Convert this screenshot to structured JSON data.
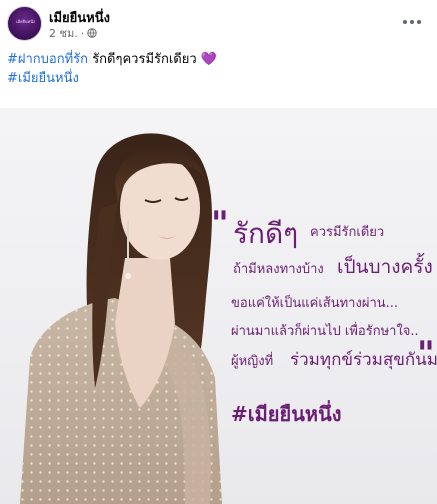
{
  "post": {
    "author": "เมียยืนหนึ่ง",
    "time": "2 ชม.",
    "separator": "·",
    "privacy_icon": "globe-icon",
    "more_icon": "more-options-icon",
    "avatar_text": "เมียยืนหนึ่ง"
  },
  "caption": {
    "hashtag1": "#ฝากบอกที่รัก",
    "text": "รักดีๆควรมีรักเดียว",
    "emoji": "💜",
    "hashtag2": "#เมียยืนหนึ่ง"
  },
  "image": {
    "quote_open": "\"",
    "quote_close": "\"",
    "line1_big": "รักดีๆ",
    "line1_small": "ควรมีรักเดียว",
    "line2_a": "ถ้ามีหลงทางบ้าง",
    "line2_b": "เป็นบางครั้ง",
    "line3": "ขอแค่ให้เป็นแค่เส้นทางผ่าน...",
    "line4": "ผ่านมาแล้วก็ผ่านไป  เพื่อรักษาใจ..",
    "line5_a": "ผู้หญิงที่",
    "line5_b": "ร่วมทุกข์ร่วมสุขกันมา",
    "hashtag": "#เมียยืนหนึ่ง",
    "accent_color": "#6b1f74"
  }
}
